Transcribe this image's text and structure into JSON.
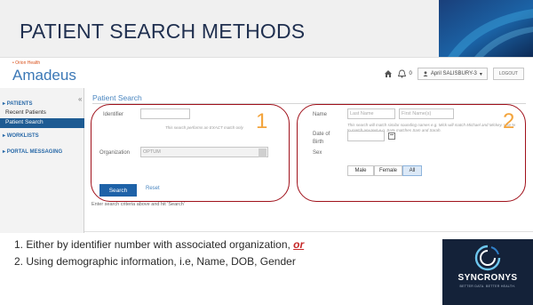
{
  "slide": {
    "title": "PATIENT SEARCH METHODS"
  },
  "app": {
    "brand_sub": "• Orion Health",
    "brand": "Amadeus",
    "notification_count": "0",
    "user": "April SALISBURY-3",
    "logout": "LOGOUT"
  },
  "sidebar": {
    "sections": [
      {
        "label": "PATIENTS"
      },
      {
        "label": "WORKLISTS"
      },
      {
        "label": "PORTAL MESSAGING"
      }
    ],
    "items": [
      {
        "label": "Recent Patients"
      },
      {
        "label": "Patient Search"
      }
    ],
    "collapse_glyph": "«"
  },
  "panel": {
    "title": "Patient Search",
    "identifier_label": "Identifier",
    "identifier_hint": "This search performs an EXACT match only",
    "organization_label": "Organization",
    "organization_value": "OPTUM",
    "name_label": "Name",
    "last_name_placeholder": "Last Name",
    "first_name_placeholder": "First Name(s)",
    "name_hint": "This search will match similar sounding names e.g. Mick will match Michael and Mickey. Use % to match any text e.g. Sa% matches Sam and Sarah.",
    "dob_label_1": "Date of",
    "dob_label_2": "Birth",
    "sex_label": "Sex",
    "sex_options": [
      "Male",
      "Female",
      "All"
    ],
    "sex_selected": "All",
    "search_button": "Search",
    "reset_link": "Reset",
    "enter_hint": "Enter search criteria above and hit 'Search'",
    "annotation_1": "1",
    "annotation_2": "2"
  },
  "bullets": {
    "item1_text": "1.   Either by identifier number with associated organization, ",
    "item1_or": "or",
    "item2_text": "2.   Using demographic information, i.e, Name, DOB, Gender"
  },
  "logo": {
    "name": "SYNCRONYS",
    "tagline": "BETTER DATA. BETTER HEALTH."
  },
  "colors": {
    "title": "#1f2f4f",
    "brand_blue": "#3b78b6",
    "annotation_orange": "#f3a43c",
    "annotation_box": "#a0111b",
    "or_red": "#c62828",
    "logo_bg": "#142239"
  }
}
